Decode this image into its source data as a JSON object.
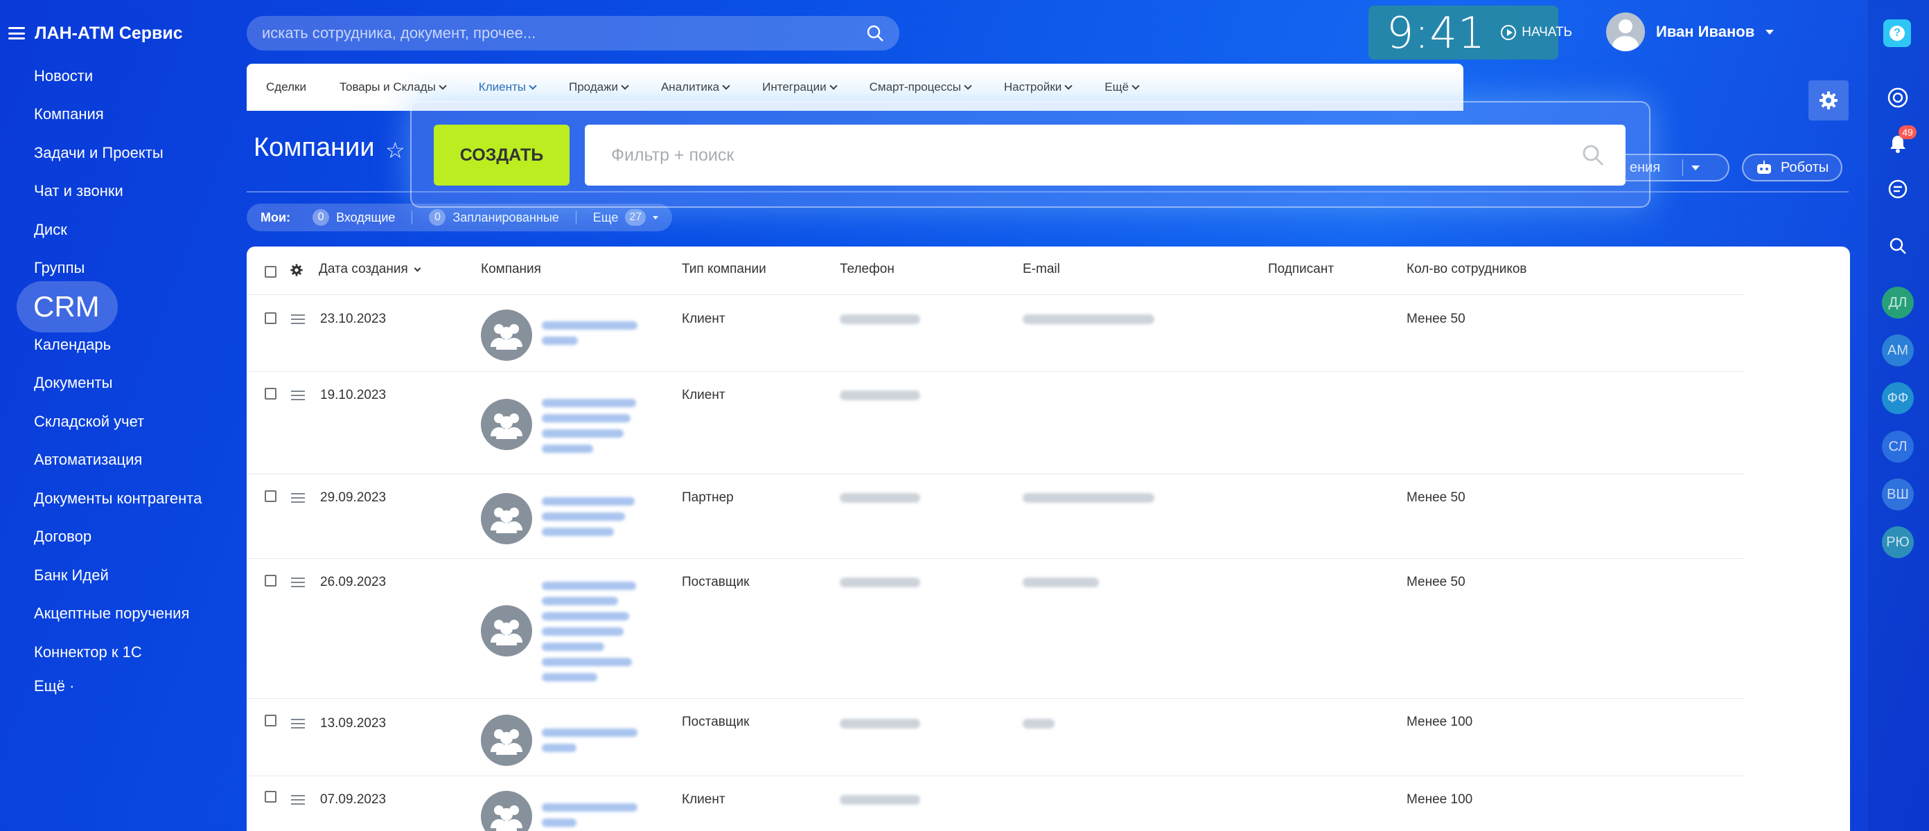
{
  "app": {
    "title": "ЛАН-АТМ Сервис"
  },
  "left_nav": {
    "items": [
      "Новости",
      "Компания",
      "Задачи и Проекты",
      "Чат и звонки",
      "Диск",
      "Группы",
      "Календарь",
      "Документы",
      "Складской учет",
      "Автоматизация",
      "Документы контрагента",
      "Договор",
      "Банк Идей",
      "Акцептные поручения",
      "Коннектор к 1С",
      "Ещё ·"
    ],
    "active": "CRM"
  },
  "search": {
    "placeholder": "искать сотрудника, документ, прочее..."
  },
  "timer": {
    "time": "9:41",
    "start_label": "НАЧАТЬ"
  },
  "user": {
    "name": "Иван Иванов"
  },
  "right_rail": {
    "notifications_count": "49",
    "initials": [
      "ДЛ",
      "АМ",
      "ФФ",
      "СЛ",
      "ВШ",
      "РЮ"
    ],
    "help": "?"
  },
  "top_menu": {
    "items": [
      {
        "label": "Сделки",
        "dropdown": false,
        "active": false
      },
      {
        "label": "Товары и Склады",
        "dropdown": true,
        "active": false
      },
      {
        "label": "Клиенты",
        "dropdown": true,
        "active": true
      },
      {
        "label": "Продажи",
        "dropdown": true,
        "active": false
      },
      {
        "label": "Аналитика",
        "dropdown": true,
        "active": false
      },
      {
        "label": "Интеграции",
        "dropdown": true,
        "active": false
      },
      {
        "label": "Смарт-процессы",
        "dropdown": true,
        "active": false
      },
      {
        "label": "Настройки",
        "dropdown": true,
        "active": false
      },
      {
        "label": "Ещё",
        "dropdown": true,
        "active": false
      }
    ]
  },
  "page": {
    "title": "Компании"
  },
  "toolbar": {
    "applications_label": "ения",
    "robots_label": "Роботы"
  },
  "overlay": {
    "create_label": "СОЗДАТЬ",
    "filter_placeholder": "Фильтр + поиск"
  },
  "counters": {
    "mine_label": "Мои:",
    "incoming": {
      "count": "0",
      "label": "Входящие"
    },
    "planned": {
      "count": "0",
      "label": "Запланированные"
    },
    "more": {
      "label": "Еще",
      "count": "27"
    }
  },
  "grid": {
    "columns": [
      "Дата создания",
      "Компания",
      "Тип компании",
      "Телефон",
      "E-mail",
      "Подписант",
      "Кол-во сотрудников"
    ],
    "rows": [
      {
        "date": "23.10.2023",
        "type": "Клиент",
        "employees": "Менее 50"
      },
      {
        "date": "19.10.2023",
        "type": "Клиент",
        "employees": ""
      },
      {
        "date": "29.09.2023",
        "type": "Партнер",
        "employees": "Менее 50"
      },
      {
        "date": "26.09.2023",
        "type": "Поставщик",
        "employees": "Менее 50"
      },
      {
        "date": "13.09.2023",
        "type": "Поставщик",
        "employees": "Менее 100"
      },
      {
        "date": "07.09.2023",
        "type": "Клиент",
        "employees": "Менее 100"
      }
    ]
  },
  "colors": {
    "accent_green": "#bbed21",
    "link_blue": "#2066b0",
    "help_cyan": "#2fc6f6",
    "badge_red": "#ff5752"
  }
}
